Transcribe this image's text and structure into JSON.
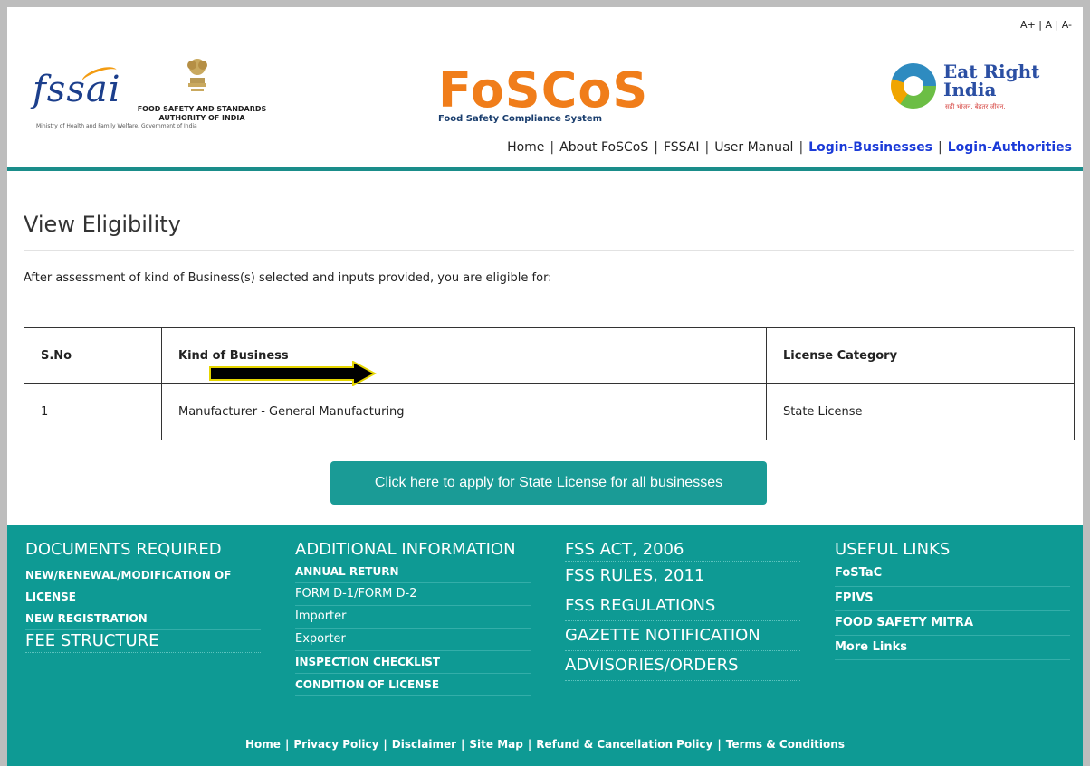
{
  "font_size": {
    "larger": "A+",
    "normal": "A",
    "smaller": "A-"
  },
  "logos": {
    "fssai": {
      "word": "fssai",
      "name_line1": "FOOD SAFETY AND STANDARDS",
      "name_line2": "AUTHORITY OF INDIA",
      "ministry": "Ministry of Health and Family Welfare, Government of India"
    },
    "foscos": {
      "word": "FoSCoS",
      "subtitle": "Food Safety Compliance System"
    },
    "eatright": {
      "line1": "Eat Right",
      "line2": "India",
      "tagline": "सही भोजन. बेहतर जीवन."
    }
  },
  "nav": {
    "home": "Home",
    "about": "About FoSCoS",
    "fssai": "FSSAI",
    "manual": "User Manual",
    "login_business": "Login-Businesses",
    "login_authorities": "Login-Authorities"
  },
  "page": {
    "title": "View Eligibility",
    "intro": "After assessment of kind of Business(s) selected and inputs provided, you are eligible for:"
  },
  "table": {
    "headers": {
      "sno": "S.No",
      "kind": "Kind of Business",
      "category": "License Category"
    },
    "rows": [
      {
        "sno": "1",
        "kind": "Manufacturer - General Manufacturing",
        "category": "State License"
      }
    ]
  },
  "apply_button": "Click here to apply for State License for all businesses",
  "footer": {
    "documents": {
      "heading": "DOCUMENTS REQUIRED",
      "item1": "NEW/RENEWAL/MODIFICATION OF LICENSE",
      "item2": "NEW REGISTRATION",
      "item3": "FEE STRUCTURE"
    },
    "additional": {
      "heading": "ADDITIONAL INFORMATION",
      "item1": "ANNUAL RETURN",
      "item2": "FORM D-1/FORM D-2",
      "item3": "Importer",
      "item4": "Exporter",
      "item5": "INSPECTION CHECKLIST",
      "item6": "CONDITION OF LICENSE"
    },
    "acts": {
      "item1": "FSS ACT, 2006",
      "item2": "FSS RULES, 2011",
      "item3": "FSS REGULATIONS",
      "item4": "GAZETTE NOTIFICATION",
      "item5": "ADVISORIES/ORDERS"
    },
    "useful": {
      "heading": "USEFUL LINKS",
      "item1": "FoSTaC",
      "item2": "FPIVS",
      "item3": "FOOD SAFETY MITRA",
      "item4": "More Links"
    },
    "bottom": {
      "home": "Home",
      "privacy": "Privacy Policy",
      "disclaimer": "Disclaimer",
      "sitemap": "Site Map",
      "refund": "Refund & Cancellation Policy",
      "terms": "Terms & Conditions"
    }
  },
  "colors": {
    "teal": "#0e9a94",
    "button": "#1a9b96",
    "orange": "#f07d1a",
    "link_blue": "#1a3ad8"
  }
}
